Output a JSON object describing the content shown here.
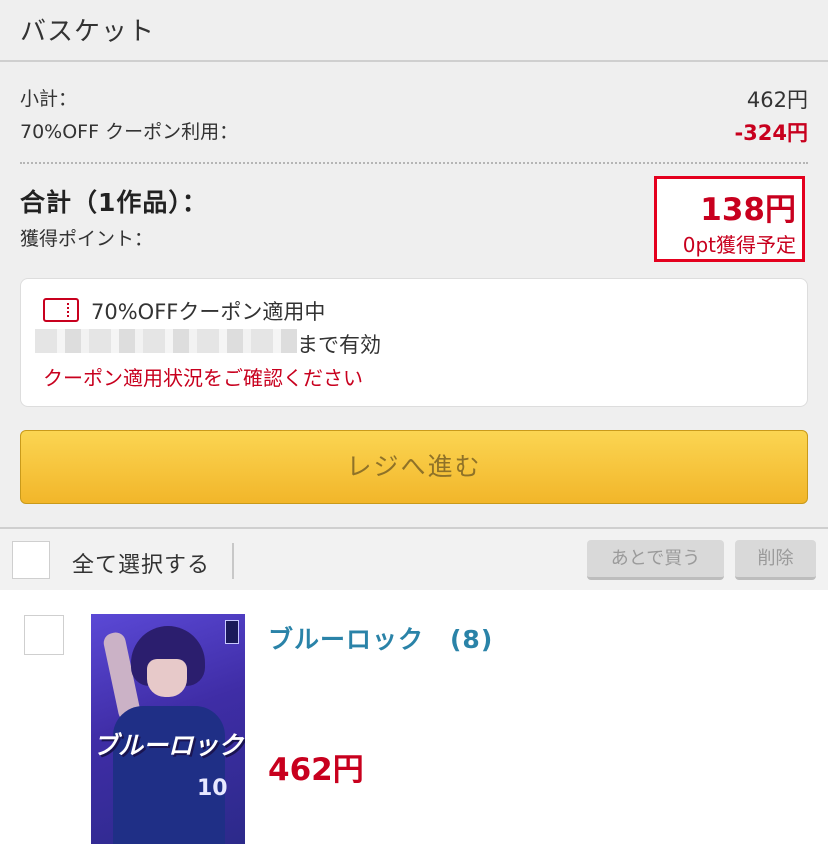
{
  "header": {
    "title": "バスケット"
  },
  "summary": {
    "subtotal_label": "小計：",
    "subtotal_value": "462円",
    "coupon_label": "70%OFF クーポン利用：",
    "coupon_value": "-324円",
    "total_label": "合計（1作品）：",
    "points_label": "獲得ポイント：",
    "total_value": "138円",
    "points_value": "0pt獲得予定"
  },
  "coupon": {
    "title": "70%OFFクーポン適用中",
    "valid_until": "まで有効",
    "link": "クーポン適用状況をご確認ください"
  },
  "checkout": {
    "label": "レジへ進む"
  },
  "selection": {
    "select_all_label": "全て選択する",
    "later_button": "あとで買う",
    "delete_button": "削除"
  },
  "items": [
    {
      "title": "ブルーロック　(8)",
      "price": "462円",
      "cover_logo": "ブルーロック",
      "cover_number": "10"
    }
  ],
  "colors": {
    "price_red": "#c8001e",
    "link_blue": "#2a83a8",
    "button_yellow": "#f7c63a"
  }
}
